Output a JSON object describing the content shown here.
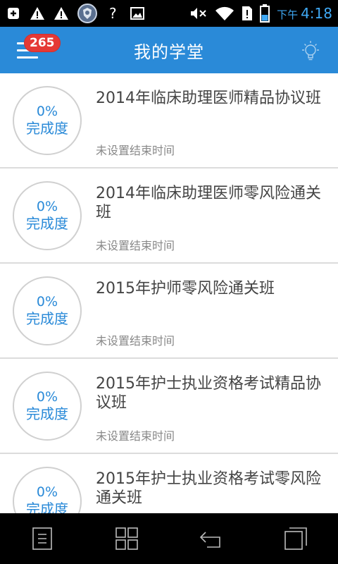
{
  "status_bar": {
    "ampm": "下午",
    "time": "4:18",
    "icons": [
      "add-notification-icon",
      "warning-icon",
      "warning-icon",
      "shield-app-icon",
      "help-icon",
      "image-icon",
      "mute-icon",
      "wifi-icon",
      "sim-alert-icon",
      "battery-icon"
    ]
  },
  "app_bar": {
    "title": "我的学堂",
    "badge": "265"
  },
  "courses": [
    {
      "percent": "0%",
      "progress_label": "完成度",
      "title": "2014年临床助理医师精品协议班",
      "subtitle": "未设置结束时间",
      "progress": 0
    },
    {
      "percent": "0%",
      "progress_label": "完成度",
      "title": "2014年临床助理医师零风险通关班",
      "subtitle": "未设置结束时间",
      "progress": 0
    },
    {
      "percent": "0%",
      "progress_label": "完成度",
      "title": "2015年护师零风险通关班",
      "subtitle": "未设置结束时间",
      "progress": 0
    },
    {
      "percent": "0%",
      "progress_label": "完成度",
      "title": "2015年护士执业资格考试精品协议班",
      "subtitle": "未设置结束时间",
      "progress": 0
    },
    {
      "percent": "0%",
      "progress_label": "完成度",
      "title": "2015年护士执业资格考试零风险通关班",
      "subtitle": "",
      "progress": 0
    }
  ],
  "colors": {
    "accent": "#2a8ad8",
    "badge": "#e53935",
    "status_bar": "#000000",
    "clock": "#3fa9f5"
  },
  "nav_bar": {
    "icons": [
      "document-icon",
      "grid-icon",
      "back-icon",
      "recent-apps-icon"
    ]
  }
}
